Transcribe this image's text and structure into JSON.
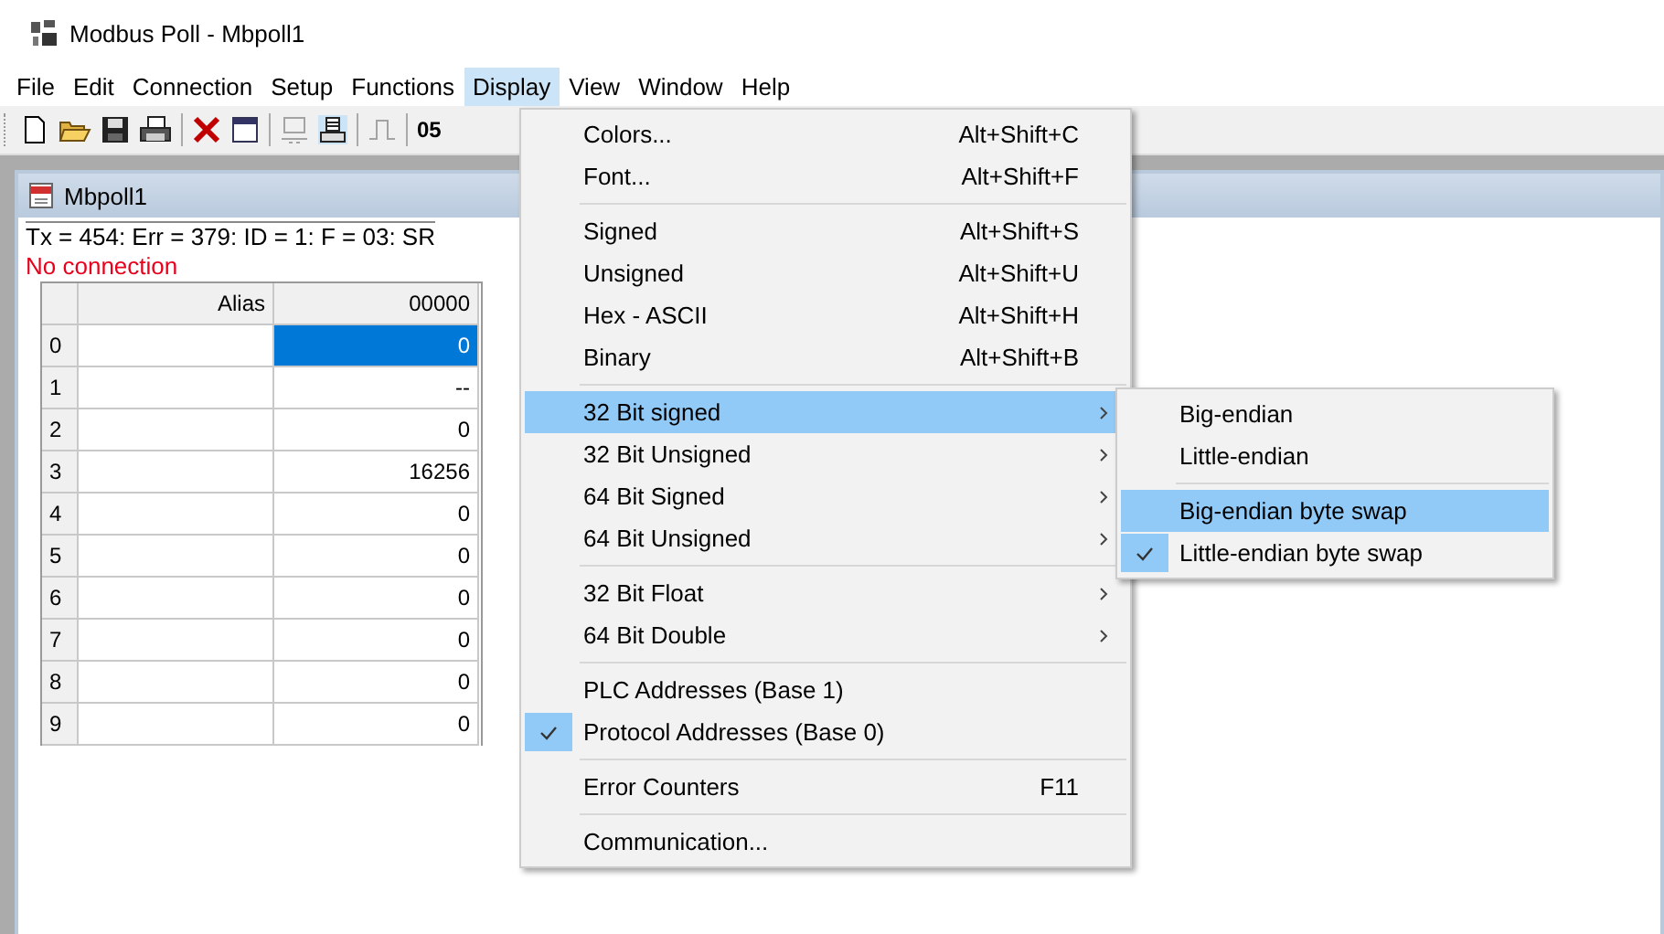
{
  "window": {
    "title": "Modbus Poll - Mbpoll1"
  },
  "menu_bar": [
    {
      "label": "File",
      "selected": false
    },
    {
      "label": "Edit",
      "selected": false
    },
    {
      "label": "Connection",
      "selected": false
    },
    {
      "label": "Setup",
      "selected": false
    },
    {
      "label": "Functions",
      "selected": false
    },
    {
      "label": "Display",
      "selected": true
    },
    {
      "label": "View",
      "selected": false
    },
    {
      "label": "Window",
      "selected": false
    },
    {
      "label": "Help",
      "selected": false
    }
  ],
  "toolbar": {
    "buttons": [
      {
        "kind": "new",
        "disabled": false
      },
      {
        "kind": "open",
        "disabled": false
      },
      {
        "kind": "save",
        "disabled": false
      },
      {
        "kind": "print",
        "disabled": false
      },
      {
        "kind": "sep"
      },
      {
        "kind": "delete",
        "disabled": false
      },
      {
        "kind": "window",
        "disabled": false
      },
      {
        "kind": "sep"
      },
      {
        "kind": "connect",
        "disabled": true
      },
      {
        "kind": "disconnect",
        "disabled": false
      },
      {
        "kind": "sep"
      },
      {
        "kind": "pulse",
        "disabled": true
      },
      {
        "kind": "sep"
      }
    ],
    "text": "05"
  },
  "document": {
    "title": "Mbpoll1",
    "status": "Tx = 454: Err = 379: ID = 1: F = 03: SR",
    "error": "No connection",
    "table": {
      "columns": [
        "Alias",
        "00000"
      ],
      "rows": [
        {
          "index": "0",
          "alias": "",
          "value": "0",
          "selected": true
        },
        {
          "index": "1",
          "alias": "",
          "value": "--",
          "selected": false
        },
        {
          "index": "2",
          "alias": "",
          "value": "0",
          "selected": false
        },
        {
          "index": "3",
          "alias": "",
          "value": "16256",
          "selected": false
        },
        {
          "index": "4",
          "alias": "",
          "value": "0",
          "selected": false
        },
        {
          "index": "5",
          "alias": "",
          "value": "0",
          "selected": false
        },
        {
          "index": "6",
          "alias": "",
          "value": "0",
          "selected": false
        },
        {
          "index": "7",
          "alias": "",
          "value": "0",
          "selected": false
        },
        {
          "index": "8",
          "alias": "",
          "value": "0",
          "selected": false
        },
        {
          "index": "9",
          "alias": "",
          "value": "0",
          "selected": false
        }
      ]
    }
  },
  "display_menu": {
    "groups": [
      [
        {
          "label": "Colors...",
          "shortcut": "Alt+Shift+C",
          "submenu": false,
          "checked": false,
          "selected": false
        },
        {
          "label": "Font...",
          "shortcut": "Alt+Shift+F",
          "submenu": false,
          "checked": false,
          "selected": false
        }
      ],
      [
        {
          "label": "Signed",
          "shortcut": "Alt+Shift+S",
          "submenu": false,
          "checked": false,
          "selected": false
        },
        {
          "label": "Unsigned",
          "shortcut": "Alt+Shift+U",
          "submenu": false,
          "checked": false,
          "selected": false
        },
        {
          "label": "Hex - ASCII",
          "shortcut": "Alt+Shift+H",
          "submenu": false,
          "checked": false,
          "selected": false
        },
        {
          "label": "Binary",
          "shortcut": "Alt+Shift+B",
          "submenu": false,
          "checked": false,
          "selected": false
        }
      ],
      [
        {
          "label": "32 Bit signed",
          "submenu": true,
          "checked": false,
          "selected": true
        },
        {
          "label": "32 Bit Unsigned",
          "submenu": true,
          "checked": false,
          "selected": false
        },
        {
          "label": "64 Bit Signed",
          "submenu": true,
          "checked": false,
          "selected": false
        },
        {
          "label": "64 Bit Unsigned",
          "submenu": true,
          "checked": false,
          "selected": false
        }
      ],
      [
        {
          "label": "32 Bit Float",
          "submenu": true,
          "checked": false,
          "selected": false
        },
        {
          "label": "64 Bit Double",
          "submenu": true,
          "checked": false,
          "selected": false
        }
      ],
      [
        {
          "label": "PLC Addresses (Base 1)",
          "submenu": false,
          "checked": false,
          "selected": false
        },
        {
          "label": "Protocol Addresses (Base 0)",
          "submenu": false,
          "checked": true,
          "selected": false
        }
      ],
      [
        {
          "label": "Error Counters",
          "shortcut": "F11",
          "submenu": false,
          "checked": false,
          "selected": false
        }
      ],
      [
        {
          "label": "Communication...",
          "submenu": false,
          "checked": false,
          "selected": false
        }
      ]
    ]
  },
  "submenu": {
    "groups": [
      [
        {
          "label": "Big-endian",
          "checked": false,
          "selected": false
        },
        {
          "label": "Little-endian",
          "checked": false,
          "selected": false
        }
      ],
      [
        {
          "label": "Big-endian byte swap",
          "checked": false,
          "selected": true
        },
        {
          "label": "Little-endian byte swap",
          "checked": true,
          "selected": false
        }
      ]
    ]
  }
}
